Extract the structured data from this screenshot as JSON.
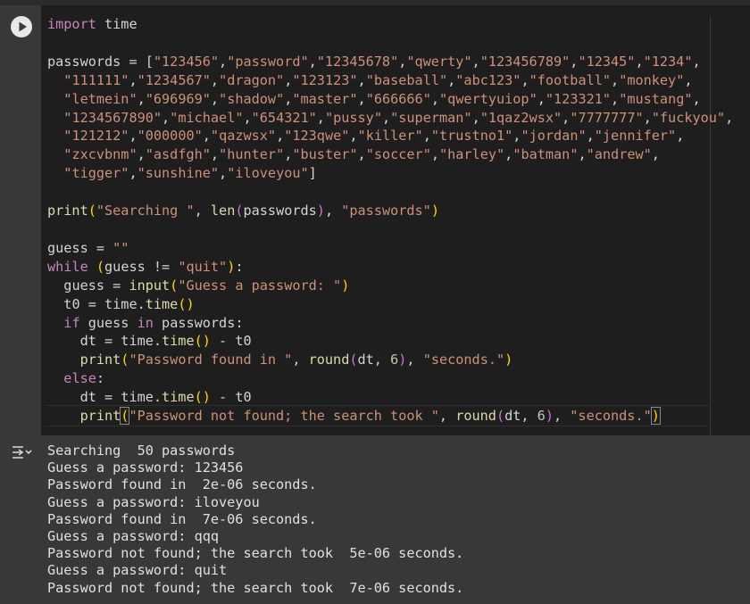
{
  "code": {
    "l1_kw": "import",
    "l1_rest": " time",
    "l3_start": "passwords = [",
    "pw_lines": [
      [
        "\"123456\"",
        "\"password\"",
        "\"12345678\"",
        "\"qwerty\"",
        "\"123456789\"",
        "\"12345\"",
        "\"1234\""
      ],
      [
        "\"111111\"",
        "\"1234567\"",
        "\"dragon\"",
        "\"123123\"",
        "\"baseball\"",
        "\"abc123\"",
        "\"football\"",
        "\"monkey\""
      ],
      [
        "\"letmein\"",
        "\"696969\"",
        "\"shadow\"",
        "\"master\"",
        "\"666666\"",
        "\"qwertyuiop\"",
        "\"123321\"",
        "\"mustang\""
      ],
      [
        "\"1234567890\"",
        "\"michael\"",
        "\"654321\"",
        "\"pussy\"",
        "\"superman\"",
        "\"1qaz2wsx\"",
        "\"7777777\"",
        "\"fuckyou\""
      ],
      [
        "\"121212\"",
        "\"000000\"",
        "\"qazwsx\"",
        "\"123qwe\"",
        "\"killer\"",
        "\"trustno1\"",
        "\"jordan\"",
        "\"jennifer\""
      ],
      [
        "\"zxcvbnm\"",
        "\"asdfgh\"",
        "\"hunter\"",
        "\"buster\"",
        "\"soccer\"",
        "\"harley\"",
        "\"batman\"",
        "\"andrew\""
      ],
      [
        "\"tigger\"",
        "\"sunshine\"",
        "\"iloveyou\""
      ]
    ],
    "print1_fn": "print",
    "print1_s1": "\"Searching \"",
    "print1_len": "len",
    "print1_arg": "passwords",
    "print1_s2": "\"passwords\"",
    "guess_init": "guess = ",
    "empty_str": "\"\"",
    "while_kw": "while",
    "while_cond": "guess != ",
    "quit_str": "\"quit\"",
    "input_lhs": "guess = ",
    "input_fn": "input",
    "input_str": "\"Guess a password: \"",
    "t0_line": "t0 = time.",
    "time_fn": "time",
    "if_kw": "if",
    "guess_var": " guess ",
    "in_kw": "in",
    "if_rest": " passwords:",
    "dt_line": "dt = time.",
    "dt_minus": " - t0",
    "print_fn": "print",
    "found_str": "\"Password found in \"",
    "round_fn": "round",
    "dt_arg": "dt, ",
    "six": "6",
    "seconds_str": "\"seconds.\"",
    "else_kw": "else",
    "notfound_str": "\"Password not found; the search took \""
  },
  "output": {
    "lines": [
      "Searching  50 passwords",
      "Guess a password: 123456",
      "Password found in  2e-06 seconds.",
      "Guess a password: iloveyou",
      "Password found in  7e-06 seconds.",
      "Guess a password: qqq",
      "Password not found; the search took  5e-06 seconds.",
      "Guess a password: quit",
      "Password not found; the search took  7e-06 seconds."
    ]
  },
  "icons": {
    "run": "play-icon",
    "output": "output-toggle-icon"
  },
  "colors": {
    "editor_bg": "#1e1e1e",
    "cell_bg": "#383838",
    "keyword": "#c586c0",
    "function": "#dcdcaa",
    "string": "#ce9178",
    "number": "#b5cea8"
  }
}
